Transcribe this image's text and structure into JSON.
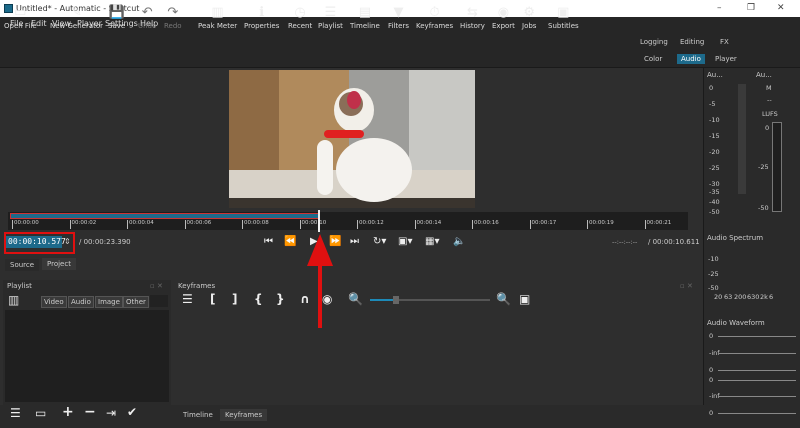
{
  "window": {
    "title": "Untitled* - Automatic - Shotcut",
    "minimize": "–",
    "maximize": "❐",
    "close": "✕"
  },
  "menu": [
    "File",
    "Edit",
    "View",
    "Player",
    "Settings",
    "Help"
  ],
  "toolbar": [
    {
      "label": "Open File",
      "icon": "folder-icon",
      "glyph": "▭",
      "enabled": true
    },
    {
      "label": "New Generator",
      "icon": "generator-icon",
      "glyph": "✎",
      "enabled": true
    },
    {
      "label": "Save",
      "icon": "save-icon",
      "glyph": "💾",
      "enabled": true
    },
    {
      "label": "Undo",
      "icon": "undo-icon",
      "glyph": "↶",
      "enabled": false
    },
    {
      "label": "Redo",
      "icon": "redo-icon",
      "glyph": "↷",
      "enabled": false
    },
    {
      "label": "Peak Meter",
      "icon": "peak-meter-icon",
      "glyph": "▥",
      "enabled": true
    },
    {
      "label": "Properties",
      "icon": "info-icon",
      "glyph": "ℹ",
      "enabled": true
    },
    {
      "label": "Recent",
      "icon": "clock-icon",
      "glyph": "◷",
      "enabled": true
    },
    {
      "label": "Playlist",
      "icon": "list-icon",
      "glyph": "☰",
      "enabled": true
    },
    {
      "label": "Timeline",
      "icon": "timeline-icon",
      "glyph": "▤",
      "enabled": true
    },
    {
      "label": "Filters",
      "icon": "filter-icon",
      "glyph": "▼",
      "enabled": true
    },
    {
      "label": "Keyframes",
      "icon": "stopwatch-icon",
      "glyph": "⏱",
      "enabled": true
    },
    {
      "label": "History",
      "icon": "history-icon",
      "glyph": "⇆",
      "enabled": true
    },
    {
      "label": "Export",
      "icon": "export-icon",
      "glyph": "◉",
      "enabled": true
    },
    {
      "label": "Jobs",
      "icon": "gear-icon",
      "glyph": "⚙",
      "enabled": true
    },
    {
      "label": "Subtitles",
      "icon": "subtitles-icon",
      "glyph": "▣",
      "enabled": true
    }
  ],
  "workspaces": {
    "row1": [
      "Logging",
      "Editing",
      "FX"
    ],
    "row2": [
      "Color",
      "Audio",
      "Player"
    ],
    "active": "Audio"
  },
  "ruler_ticks": [
    "00:00:00",
    "00:00:02",
    "00:00:04",
    "00:00:06",
    "00:00:08",
    "00:00:10",
    "00:00:12",
    "00:00:14",
    "00:00:16",
    "00:00:17",
    "00:00:19",
    "00:00:21"
  ],
  "player": {
    "timecode": "00:00:10.577",
    "duration": "/ 00:00:23.390",
    "in_out": "--:--:--:--",
    "position": "/ 00:00:10.611"
  },
  "tabs": {
    "source": "Source",
    "project": "Project"
  },
  "playlist": {
    "title": "Playlist",
    "filters": [
      "Video",
      "Audio",
      "Image",
      "Other"
    ]
  },
  "keyframes": {
    "title": "Keyframes",
    "zoom_level": 0.22
  },
  "bottom_tabs": [
    "Timeline",
    "Keyframes"
  ],
  "audio_meter": {
    "title": "Au...",
    "scale": [
      "0",
      "-5",
      "-10",
      "-15",
      "-20",
      "-25",
      "-30",
      "-35",
      "-40",
      "-50"
    ]
  },
  "loudness": {
    "title": "Au...",
    "mode": "M",
    "value": "--",
    "unit": "LUFS",
    "scale": [
      "0",
      "-25",
      "-50"
    ]
  },
  "spectrum": {
    "title": "Audio Spectrum",
    "scale": [
      "-10",
      "-25",
      "-50"
    ],
    "freqs": [
      "20",
      "63",
      "200",
      "630",
      "2k",
      "6"
    ]
  },
  "waveform": {
    "title": "Audio Waveform",
    "labels": [
      "0",
      "-inf",
      "0",
      "0",
      "-inf",
      "0"
    ]
  },
  "annotation_color": "#e01010",
  "accent": "#1d6a8b"
}
